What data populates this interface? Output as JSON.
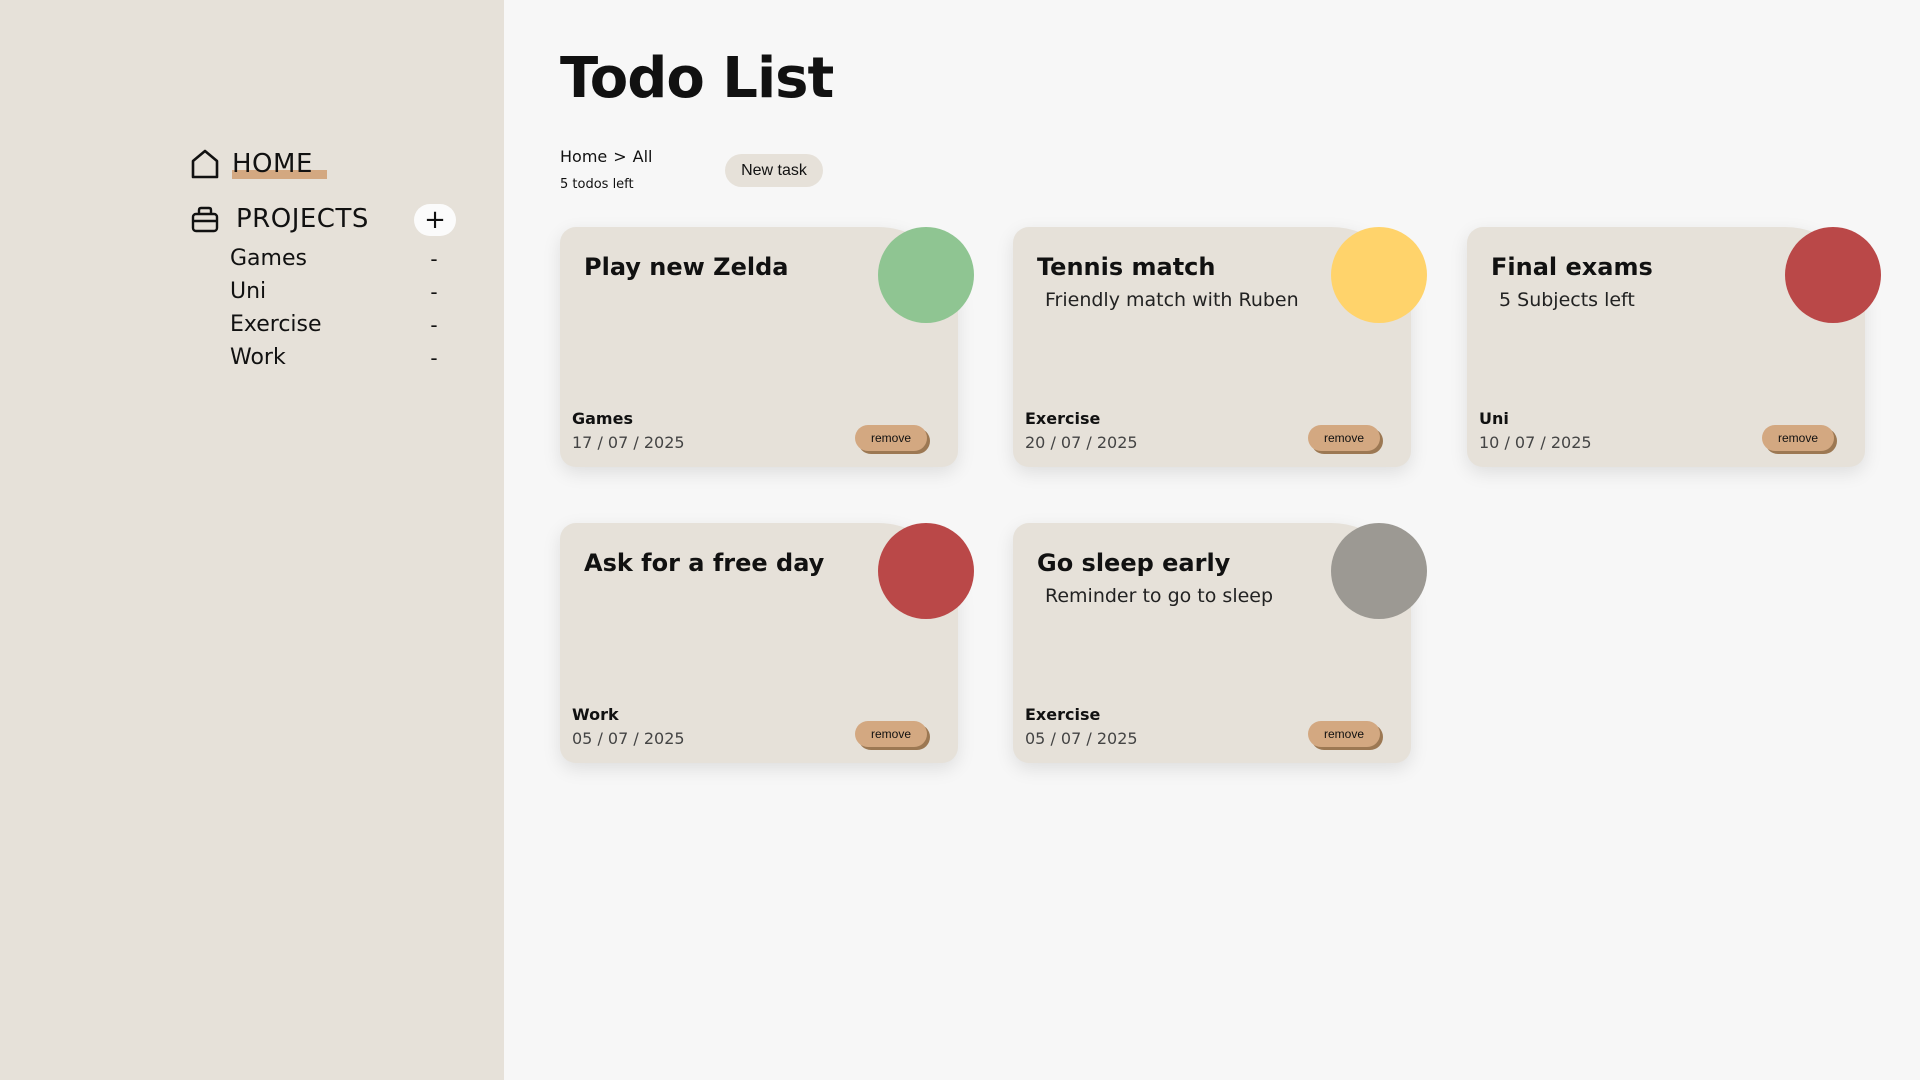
{
  "sidebar": {
    "home_label": "HOME",
    "projects_label": "PROJECTS",
    "add_project_label": "+",
    "projects": [
      {
        "label": "Games",
        "remove_label": "-"
      },
      {
        "label": "Uni",
        "remove_label": "-"
      },
      {
        "label": "Exercise",
        "remove_label": "-"
      },
      {
        "label": "Work",
        "remove_label": "-"
      }
    ]
  },
  "main": {
    "title": "Todo List",
    "breadcrumb": {
      "home": "Home",
      "separator": ">",
      "current": "All"
    },
    "todos_left": "5 todos left",
    "new_task_label": "New task"
  },
  "todos": [
    {
      "title": "Play new Zelda",
      "description": "",
      "project": "Games",
      "date": "17 / 07 / 2025",
      "priority_color": "#8fc592",
      "remove_label": "remove"
    },
    {
      "title": "Tennis match",
      "description": "Friendly match with Ruben",
      "project": "Exercise",
      "date": "20 / 07 / 2025",
      "priority_color": "#ffd36b",
      "remove_label": "remove"
    },
    {
      "title": "Final exams",
      "description": "5 Subjects left",
      "project": "Uni",
      "date": "10 / 07 / 2025",
      "priority_color": "#ba4848",
      "remove_label": "remove"
    },
    {
      "title": "Ask for a free day",
      "description": "",
      "project": "Work",
      "date": "05 / 07 / 2025",
      "priority_color": "#ba4848",
      "remove_label": "remove"
    },
    {
      "title": "Go sleep early",
      "description": "Reminder to go to sleep",
      "project": "Exercise",
      "date": "05 / 07 / 2025",
      "priority_color": "#9c9993",
      "remove_label": "remove"
    }
  ],
  "colors": {
    "sidebar_bg": "#e6e1d9",
    "page_bg": "#f7f7f7",
    "accent": "#d3a881",
    "card_bg": "#e6e1d9"
  }
}
